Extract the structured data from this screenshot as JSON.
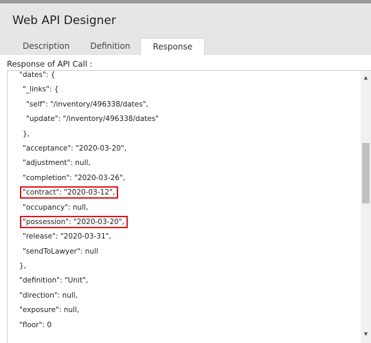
{
  "app": {
    "title": "Web API Designer"
  },
  "tabs": [
    {
      "label": "Description",
      "active": false
    },
    {
      "label": "Definition",
      "active": false
    },
    {
      "label": "Response",
      "active": true
    }
  ],
  "response": {
    "label": "Response of API Call :",
    "lines": [
      {
        "indent": 3,
        "text": "\"dates\": {"
      },
      {
        "indent": 4,
        "text": "\"_links\": {"
      },
      {
        "indent": 5,
        "text": "\"self\": \"/inventory/496338/dates\","
      },
      {
        "indent": 5,
        "text": "\"update\": \"/inventory/496338/dates\""
      },
      {
        "indent": 4,
        "text": "},"
      },
      {
        "indent": 4,
        "text": "\"acceptance\": \"2020-03-20\","
      },
      {
        "indent": 4,
        "text": "\"adjustment\": null,"
      },
      {
        "indent": 4,
        "text": "\"completion\": \"2020-03-26\","
      },
      {
        "indent": 4,
        "text": "\"contract\": \"2020-03-12\",",
        "highlight": true
      },
      {
        "indent": 4,
        "text": "\"occupancy\": null,"
      },
      {
        "indent": 4,
        "text": "\"possession\": \"2020-03-20\",",
        "highlight": true
      },
      {
        "indent": 4,
        "text": "\"release\": \"2020-03-31\","
      },
      {
        "indent": 4,
        "text": "\"sendToLawyer\": null"
      },
      {
        "indent": 3,
        "text": "},"
      },
      {
        "indent": 3,
        "text": "\"definition\": \"Unit\","
      },
      {
        "indent": 3,
        "text": "\"direction\": null,"
      },
      {
        "indent": 3,
        "text": "\"exposure\": null,"
      },
      {
        "indent": 3,
        "text": "\"floor\": 0"
      }
    ]
  },
  "scrollbar": {
    "up_icon": "triangle-up",
    "down_icon": "triangle-down"
  },
  "colors": {
    "highlight": "#e0161b",
    "header_bg": "#e6e6e6"
  }
}
